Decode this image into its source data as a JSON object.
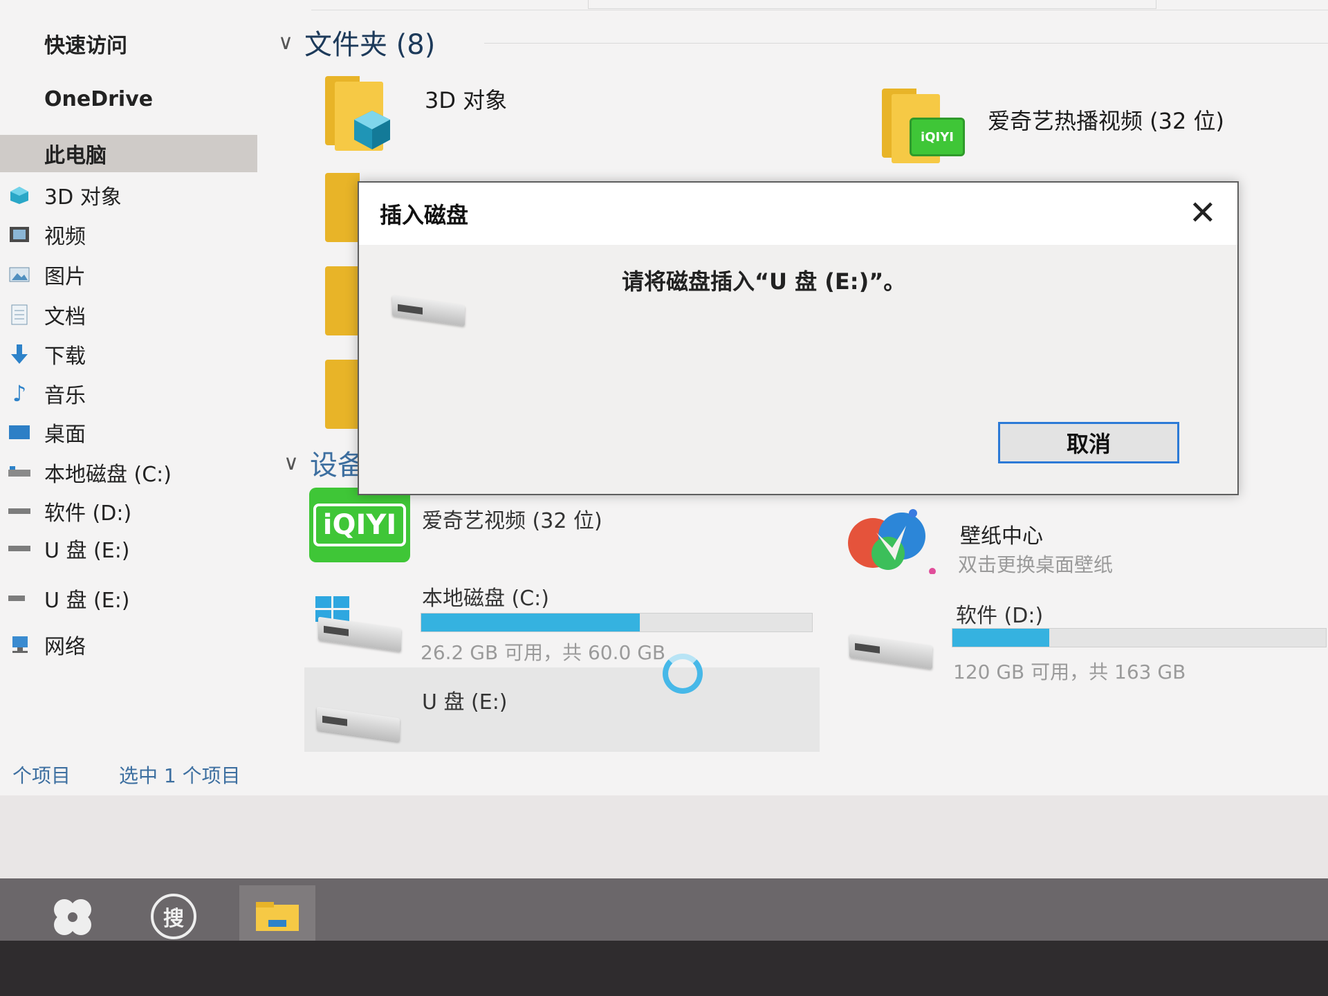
{
  "sidebar": {
    "quick_access": "快速访问",
    "onedrive": "OneDrive",
    "this_pc": "此电脑",
    "items": [
      {
        "label": "3D 对象",
        "icon": "cube-icon"
      },
      {
        "label": "视频",
        "icon": "video-icon"
      },
      {
        "label": "图片",
        "icon": "picture-icon"
      },
      {
        "label": "文档",
        "icon": "document-icon"
      },
      {
        "label": "下载",
        "icon": "download-icon"
      },
      {
        "label": "音乐",
        "icon": "music-icon"
      },
      {
        "label": "桌面",
        "icon": "desktop-icon"
      },
      {
        "label": "本地磁盘 (C:)",
        "icon": "drive-icon"
      },
      {
        "label": "软件 (D:)",
        "icon": "drive-icon"
      },
      {
        "label": "U 盘 (E:)",
        "icon": "drive-icon"
      }
    ],
    "usb_root": "U 盘 (E:)",
    "network": "网络"
  },
  "folders": {
    "header": "文件夹 (8)",
    "items": [
      {
        "label": "3D 对象"
      },
      {
        "label": "爱奇艺热播视频 (32 位)"
      }
    ]
  },
  "devices": {
    "header_partial": "设备",
    "iqiyi": {
      "label": "爱奇艺视频 (32 位)",
      "logo_text": "iQIYI"
    },
    "wallpaper": {
      "label": "壁纸中心",
      "sub": "双击更换桌面壁纸"
    },
    "drives": [
      {
        "label": "本地磁盘 (C:)",
        "sub": "26.2 GB 可用，共 60.0 GB",
        "used_fraction": 0.56
      },
      {
        "label": "软件 (D:)",
        "sub": "120 GB 可用，共 163 GB",
        "used_fraction": 0.26
      },
      {
        "label": "U 盘 (E:)"
      }
    ]
  },
  "status": {
    "count": "个项目",
    "selected": "选中 1 个项目"
  },
  "dialog": {
    "title": "插入磁盘",
    "message": "请将磁盘插入“U 盘 (E:)”。",
    "cancel": "取消",
    "close": "✕"
  },
  "taskbar": {
    "search_glyph": "搜"
  },
  "colors": {
    "accent": "#35b2e0",
    "button_border": "#2c7ad6",
    "folder": "#f6c945",
    "iqiyi": "#3fc637"
  }
}
